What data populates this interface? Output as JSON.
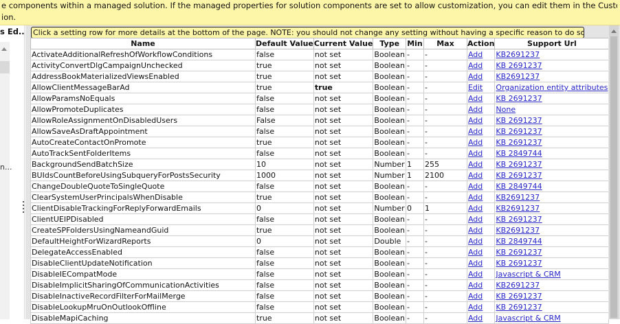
{
  "banner": {
    "line1": "e components within a managed solution. If the managed properties for solution components are set to allow customization, you can edit them in the Customizations area or from",
    "line2": "ion."
  },
  "left_panel": {
    "title": "s Ed...",
    "truncated": "n..."
  },
  "notice": "Click a setting row for more details at the bottom of the page. NOTE: you should not change any setting without having a specific reason to do so.",
  "columns": [
    "Name",
    "Default Value",
    "Current Value",
    "Type",
    "Min",
    "Max",
    "Action",
    "Support Url"
  ],
  "rows": [
    {
      "name": "ActivateAdditionalRefreshOfWorkflowConditions",
      "default": "false",
      "current": "not set",
      "type": "Boolean",
      "min": "-",
      "max": "-",
      "action": "Add",
      "url": "KB2691237"
    },
    {
      "name": "ActivityConvertDlgCampaignUnchecked",
      "default": "true",
      "current": "not set",
      "type": "Boolean",
      "min": "-",
      "max": "-",
      "action": "Add",
      "url": "KB 2691237"
    },
    {
      "name": "AddressBookMaterializedViewsEnabled",
      "default": "true",
      "current": "not set",
      "type": "Boolean",
      "min": "-",
      "max": "-",
      "action": "Add",
      "url": "KB2691237"
    },
    {
      "name": "AllowClientMessageBarAd",
      "default": "true",
      "current": "true",
      "type": "Boolean",
      "min": "-",
      "max": "-",
      "action": "Edit",
      "url": "Organization entity attributes"
    },
    {
      "name": "AllowParamsNoEquals",
      "default": "false",
      "current": "not set",
      "type": "Boolean",
      "min": "-",
      "max": "-",
      "action": "Add",
      "url": "KB 2691237"
    },
    {
      "name": "AllowPromoteDuplicates",
      "default": "false",
      "current": "not set",
      "type": "Boolean",
      "min": "-",
      "max": "-",
      "action": "Add",
      "url": "None"
    },
    {
      "name": "AllowRoleAssignmentOnDisabledUsers",
      "default": "False",
      "current": "not set",
      "type": "Boolean",
      "min": "-",
      "max": "-",
      "action": "Add",
      "url": "KB 2691237"
    },
    {
      "name": "AllowSaveAsDraftAppointment",
      "default": "false",
      "current": "not set",
      "type": "Boolean",
      "min": "-",
      "max": "-",
      "action": "Add",
      "url": "KB 2691237"
    },
    {
      "name": "AutoCreateContactOnPromote",
      "default": "true",
      "current": "not set",
      "type": "Boolean",
      "min": "-",
      "max": "-",
      "action": "Add",
      "url": "KB 2691237"
    },
    {
      "name": "AutoTrackSentFolderItems",
      "default": "false",
      "current": "not set",
      "type": "Boolean",
      "min": "-",
      "max": "-",
      "action": "Add",
      "url": "KB 2849744"
    },
    {
      "name": "BackgroundSendBatchSize",
      "default": "10",
      "current": "not set",
      "type": "Number",
      "min": "1",
      "max": "255",
      "action": "Add",
      "url": "KB 2691237"
    },
    {
      "name": "BUIdsCountBeforeUsingSubqueryForPostsSecurity",
      "default": "1000",
      "current": "not set",
      "type": "Number",
      "min": "1",
      "max": "2100",
      "action": "Add",
      "url": "KB 2691237"
    },
    {
      "name": "ChangeDoubleQuoteToSingleQuote",
      "default": "false",
      "current": "not set",
      "type": "Boolean",
      "min": "-",
      "max": "-",
      "action": "Add",
      "url": "KB 2849744"
    },
    {
      "name": "ClearSystemUserPrincipalsWhenDisable",
      "default": "true",
      "current": "not set",
      "type": "Boolean",
      "min": "-",
      "max": "-",
      "action": "Add",
      "url": "KB2691237"
    },
    {
      "name": "ClientDisableTrackingForReplyForwardEmails",
      "default": "0",
      "current": "not set",
      "type": "Number",
      "min": "0",
      "max": "1",
      "action": "Add",
      "url": "KB2691237"
    },
    {
      "name": "ClientUEIPDisabled",
      "default": "false",
      "current": "not set",
      "type": "Boolean",
      "min": "-",
      "max": "-",
      "action": "Add",
      "url": "KB 2691237"
    },
    {
      "name": "CreateSPFoldersUsingNameandGuid",
      "default": "true",
      "current": "not set",
      "type": "Boolean",
      "min": "-",
      "max": "-",
      "action": "Add",
      "url": "KB2691237"
    },
    {
      "name": "DefaultHeightForWizardReports",
      "default": "0",
      "current": "not set",
      "type": "Double",
      "min": "-",
      "max": "-",
      "action": "Add",
      "url": "KB 2849744"
    },
    {
      "name": "DelegateAccessEnabled",
      "default": "false",
      "current": "not set",
      "type": "Boolean",
      "min": "-",
      "max": "-",
      "action": "Add",
      "url": "KB 2691237"
    },
    {
      "name": "DisableClientUpdateNotification",
      "default": "false",
      "current": "not set",
      "type": "Boolean",
      "min": "-",
      "max": "-",
      "action": "Add",
      "url": "KB 2691237"
    },
    {
      "name": "DisableIECompatMode",
      "default": "false",
      "current": "not set",
      "type": "Boolean",
      "min": "-",
      "max": "-",
      "action": "Add",
      "url": "Javascript & CRM"
    },
    {
      "name": "DisableImplicitSharingOfCommunicationActivities",
      "default": "false",
      "current": "not set",
      "type": "Boolean",
      "min": "-",
      "max": "-",
      "action": "Add",
      "url": "KB2691237"
    },
    {
      "name": "DisableInactiveRecordFilterForMailMerge",
      "default": "false",
      "current": "not set",
      "type": "Boolean",
      "min": "-",
      "max": "-",
      "action": "Add",
      "url": "KB 2691237"
    },
    {
      "name": "DisableLookupMruOnOutlookOffline",
      "default": "false",
      "current": "not set",
      "type": "Boolean",
      "min": "-",
      "max": "-",
      "action": "Add",
      "url": "KB 2691237"
    },
    {
      "name": "DisableMapiCaching",
      "default": "true",
      "current": "not set",
      "type": "Boolean",
      "min": "-",
      "max": "-",
      "action": "Add",
      "url": "Javascript & CRM"
    }
  ],
  "colors": {
    "banner": "#fdf5a8",
    "link": "#2525c8",
    "panel_bg": "#e4e4e4"
  }
}
